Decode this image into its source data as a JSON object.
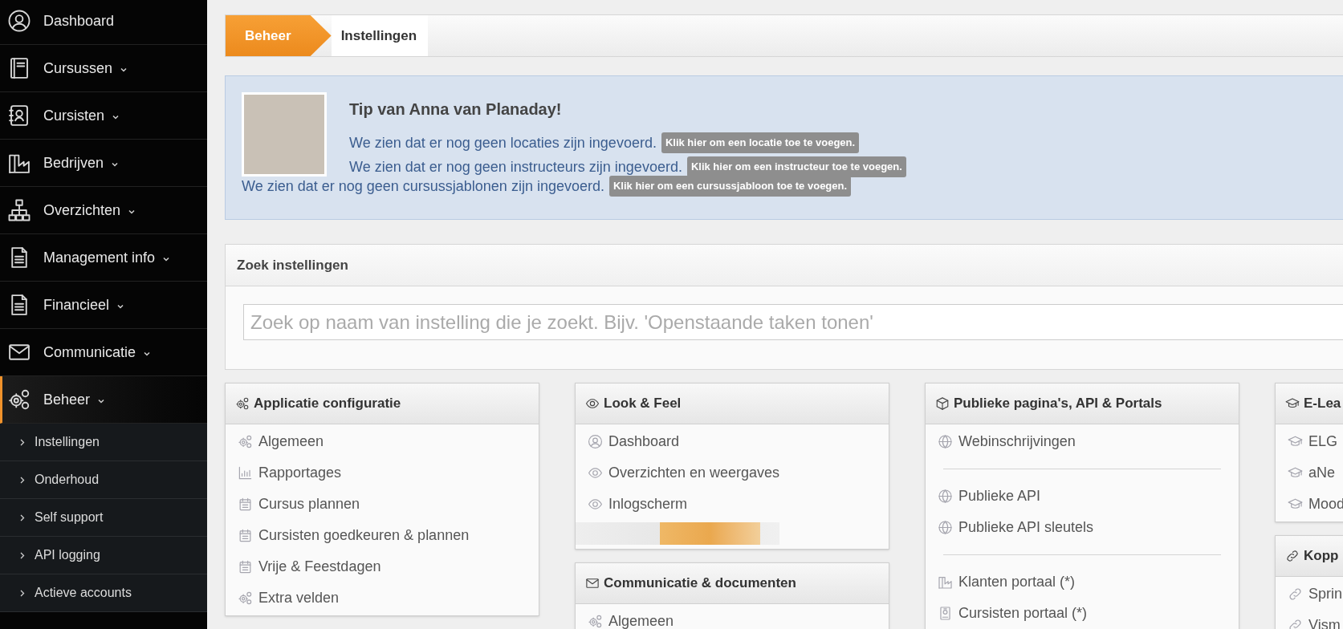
{
  "sidebar": {
    "items": [
      {
        "kind": "user",
        "label": "Dashboard",
        "selected": false,
        "has_submenu": false
      },
      {
        "kind": "book",
        "label": "Cursussen",
        "selected": false,
        "has_submenu": true
      },
      {
        "kind": "contact",
        "label": "Cursisten",
        "selected": false,
        "has_submenu": true
      },
      {
        "kind": "factory",
        "label": "Bedrijven",
        "selected": false,
        "has_submenu": true
      },
      {
        "kind": "tree",
        "label": "Overzichten",
        "selected": false,
        "has_submenu": true
      },
      {
        "kind": "document",
        "label": "Management info",
        "selected": false,
        "has_submenu": true
      },
      {
        "kind": "document",
        "label": "Financieel",
        "selected": false,
        "has_submenu": true
      },
      {
        "kind": "envelope",
        "label": "Communicatie",
        "selected": false,
        "has_submenu": true
      },
      {
        "kind": "gears",
        "label": "Beheer",
        "selected": true,
        "has_submenu": true,
        "children": [
          {
            "label": "Instellingen"
          },
          {
            "label": "Onderhoud"
          },
          {
            "label": "Self support"
          },
          {
            "label": "API logging"
          },
          {
            "label": "Actieve accounts"
          }
        ]
      }
    ]
  },
  "breadcrumb": {
    "section": "Beheer",
    "page": "Instellingen"
  },
  "tip": {
    "title": "Tip van Anna van Planaday!",
    "lines": [
      {
        "text": "We zien dat er nog geen locaties zijn ingevoerd.",
        "action": "Klik hier om een locatie toe te voegen."
      },
      {
        "text": "We zien dat er nog geen instructeurs zijn ingevoerd.",
        "action": "Klik hier om een instructeur toe te voegen."
      },
      {
        "text": "We zien dat er nog geen cursussjablonen zijn ingevoerd.",
        "action": "Klik hier om een cursussjabloon toe te voegen."
      }
    ]
  },
  "search": {
    "title": "Zoek instellingen",
    "placeholder": "Zoek op naam van instelling die je zoekt. Bijv. 'Openstaande taken tonen'"
  },
  "columns": [
    [
      {
        "kind": "gears",
        "title": "Applicatie configuratie",
        "items": [
          {
            "kind": "gears",
            "label": "Algemeen"
          },
          {
            "kind": "bars",
            "label": "Rapportages"
          },
          {
            "kind": "calendar",
            "label": "Cursus plannen"
          },
          {
            "kind": "calendar",
            "label": "Cursisten goedkeuren & plannen"
          },
          {
            "kind": "calendar",
            "label": "Vrije & Feestdagen"
          },
          {
            "kind": "gears",
            "label": "Extra velden"
          }
        ]
      }
    ],
    [
      {
        "kind": "eye",
        "title": "Look & Feel",
        "items": [
          {
            "kind": "user",
            "label": "Dashboard"
          },
          {
            "kind": "eye",
            "label": "Overzichten en weergaves"
          },
          {
            "kind": "eye",
            "label": "Inlogscherm"
          },
          {
            "kind": "blurred"
          }
        ]
      },
      {
        "kind": "envelope",
        "title": "Communicatie & documenten",
        "items": [
          {
            "kind": "gears",
            "label": "Algemeen"
          }
        ]
      }
    ],
    [
      {
        "kind": "cube",
        "title": "Publieke pagina's, API & Portals",
        "items": [
          {
            "kind": "globe",
            "label": "Webinschrijvingen"
          },
          {
            "kind": "divider"
          },
          {
            "kind": "globe",
            "label": "Publieke API"
          },
          {
            "kind": "globe",
            "label": "Publieke API sleutels"
          },
          {
            "kind": "divider"
          },
          {
            "kind": "factory",
            "label": "Klanten portaal (*)"
          },
          {
            "kind": "badge",
            "label": "Cursisten portaal (*)"
          }
        ]
      }
    ],
    [
      {
        "kind": "cap",
        "title": "E-Lea",
        "items": [
          {
            "kind": "cap",
            "label": "ELG"
          },
          {
            "kind": "cap",
            "label": "aNe"
          },
          {
            "kind": "cap",
            "label": "Mood"
          }
        ]
      },
      {
        "kind": "link",
        "title": "Kopp",
        "items": [
          {
            "kind": "link",
            "label": "Sprin"
          },
          {
            "kind": "link",
            "label": "Vism"
          }
        ]
      }
    ]
  ]
}
